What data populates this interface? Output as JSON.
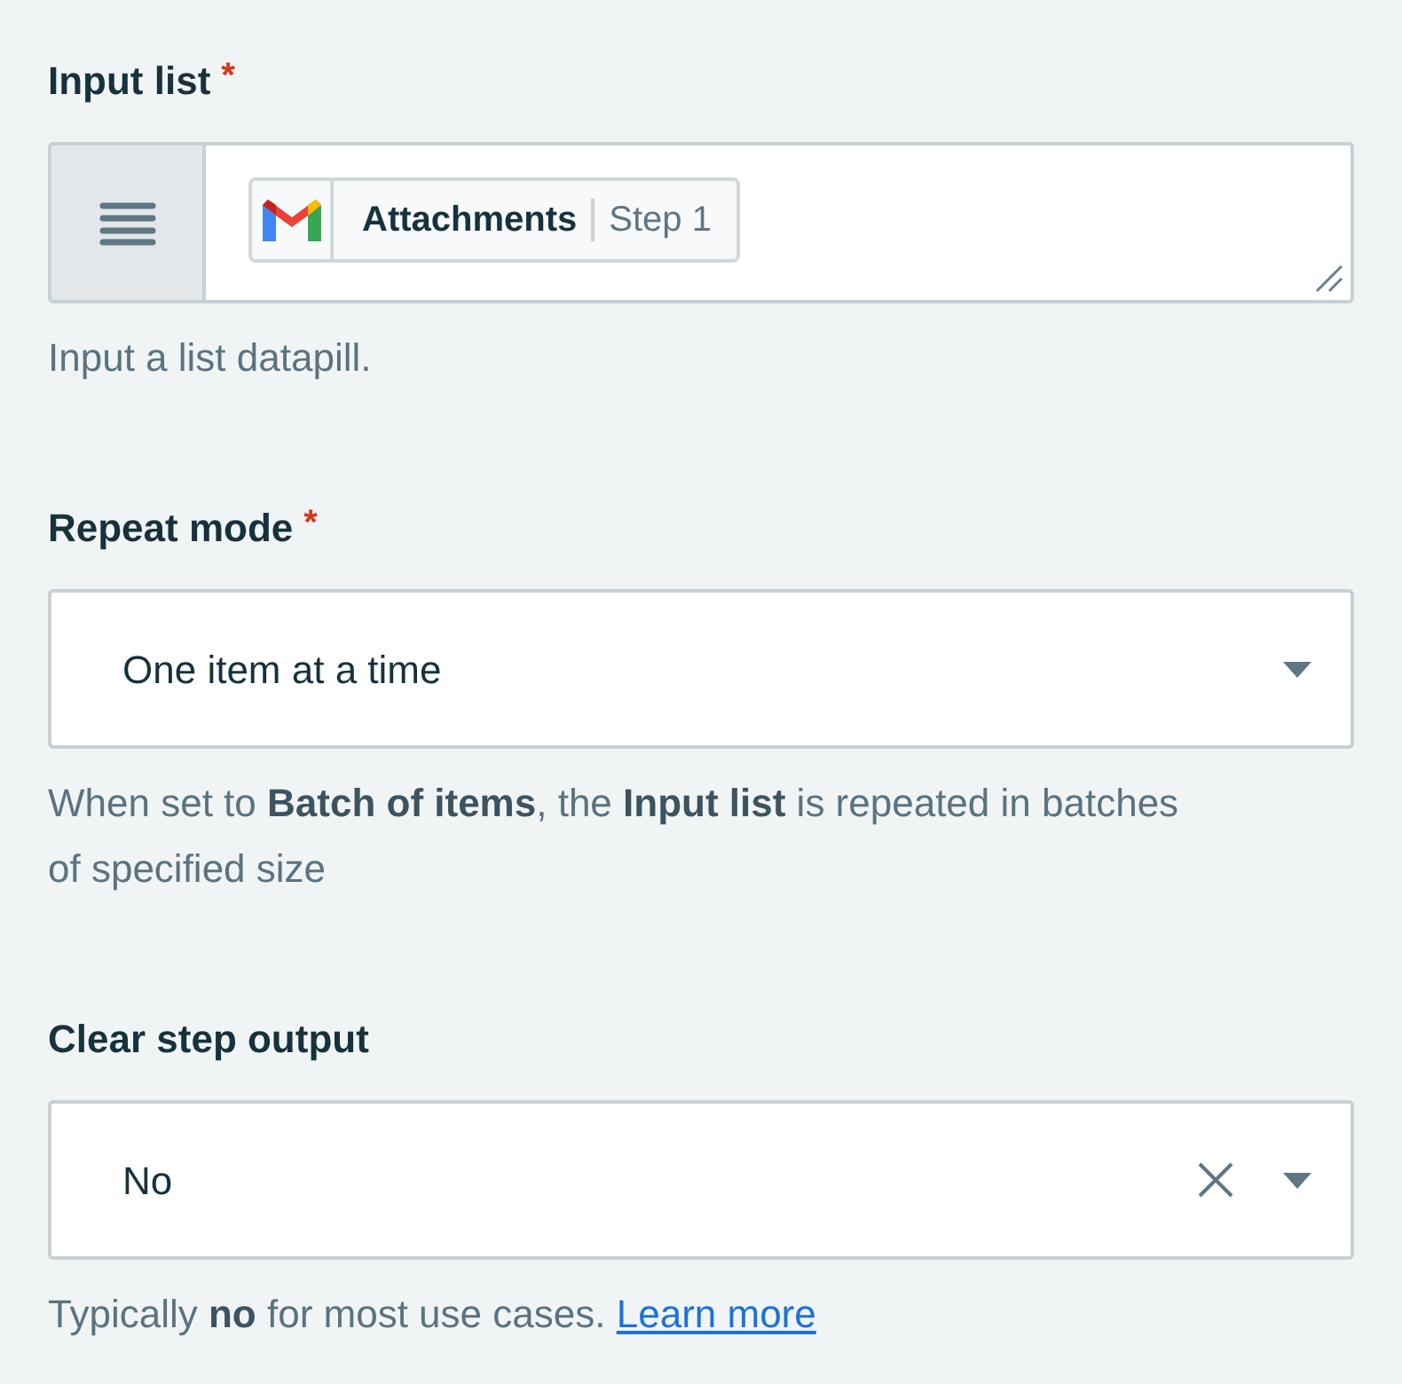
{
  "fields": [
    {
      "kind": "pill_list",
      "label": "Input list",
      "required": true,
      "pill": {
        "name": "Attachments",
        "step": "Step 1"
      },
      "hint": "Input a list datapill."
    },
    {
      "kind": "select",
      "label": "Repeat mode",
      "required": true,
      "value": "One item at a time",
      "clearable": false,
      "hint": "When set to **Batch of items**, the **Input list** is repeated in batches of specified size"
    },
    {
      "kind": "select",
      "label": "Clear step output",
      "required": false,
      "value": "No",
      "clearable": true,
      "hint": "Typically **no** for most use cases.",
      "link": "Learn more"
    }
  ],
  "required_mark": "*"
}
